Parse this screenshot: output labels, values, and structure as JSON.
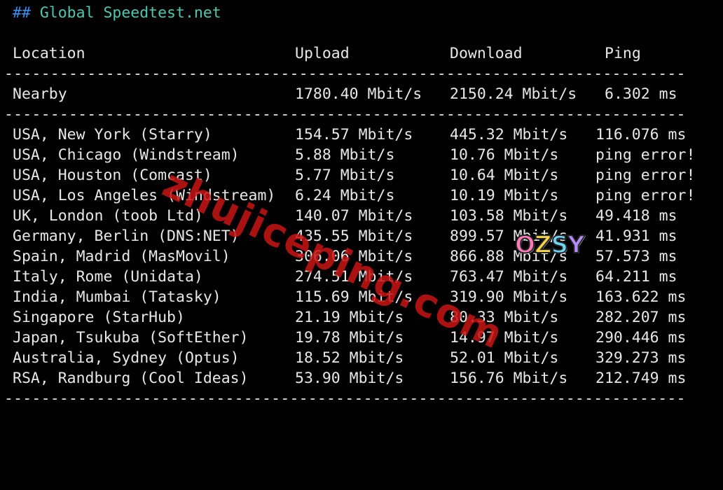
{
  "title": {
    "hashes": "##",
    "text": "Global Speedtest.net"
  },
  "header": {
    "location": "Location",
    "upload": "Upload",
    "download": "Download",
    "ping": "Ping"
  },
  "separator": "-----------------------------------------------------------------------------",
  "nearby": {
    "location": "Nearby",
    "upload": "1780.40 Mbit/s",
    "download": "2150.24 Mbit/s",
    "ping": "6.302 ms"
  },
  "rows": [
    {
      "location": "USA, New York (Starry)",
      "upload": "154.57 Mbit/s",
      "download": "445.32 Mbit/s",
      "ping": "116.076 ms"
    },
    {
      "location": "USA, Chicago (Windstream)",
      "upload": "5.88 Mbit/s",
      "download": "10.76 Mbit/s",
      "ping": "ping error!"
    },
    {
      "location": "USA, Houston (Comcast)",
      "upload": "5.77 Mbit/s",
      "download": "10.64 Mbit/s",
      "ping": "ping error!"
    },
    {
      "location": "USA, Los Angeles (Windstream)",
      "upload": "6.24 Mbit/s",
      "download": "10.19 Mbit/s",
      "ping": "ping error!"
    },
    {
      "location": "UK, London (toob Ltd)",
      "upload": "140.07 Mbit/s",
      "download": "103.58 Mbit/s",
      "ping": "49.418 ms"
    },
    {
      "location": "Germany, Berlin (DNS:NET)",
      "upload": "435.55 Mbit/s",
      "download": "899.57 Mbit/s",
      "ping": "41.931 ms"
    },
    {
      "location": "Spain, Madrid (MasMovil)",
      "upload": "306.06 Mbit/s",
      "download": "866.88 Mbit/s",
      "ping": "57.573 ms"
    },
    {
      "location": "Italy, Rome (Unidata)",
      "upload": "274.51 Mbit/s",
      "download": "763.47 Mbit/s",
      "ping": "64.211 ms"
    },
    {
      "location": "India, Mumbai (Tatasky)",
      "upload": "115.69 Mbit/s",
      "download": "319.90 Mbit/s",
      "ping": "163.622 ms"
    },
    {
      "location": "Singapore (StarHub)",
      "upload": "21.19 Mbit/s",
      "download": "80.33 Mbit/s",
      "ping": "282.207 ms"
    },
    {
      "location": "Japan, Tsukuba (SoftEther)",
      "upload": "19.78 Mbit/s",
      "download": "14.97 Mbit/s",
      "ping": "290.446 ms"
    },
    {
      "location": "Australia, Sydney (Optus)",
      "upload": "18.52 Mbit/s",
      "download": "52.01 Mbit/s",
      "ping": "329.273 ms"
    },
    {
      "location": "RSA, Randburg (Cool Ideas)",
      "upload": "53.90 Mbit/s",
      "download": "156.76 Mbit/s",
      "ping": "212.749 ms"
    }
  ],
  "watermark": "zhujiceping.com",
  "logo": {
    "l1": "O",
    "l2": "Z",
    "l3": "S",
    "l4": "Y"
  },
  "colors": {
    "background": "#000000",
    "text": "#e8e8e8",
    "title": "#4ec9b0",
    "hashes": "#3b8eea",
    "watermark": "#c81414"
  }
}
